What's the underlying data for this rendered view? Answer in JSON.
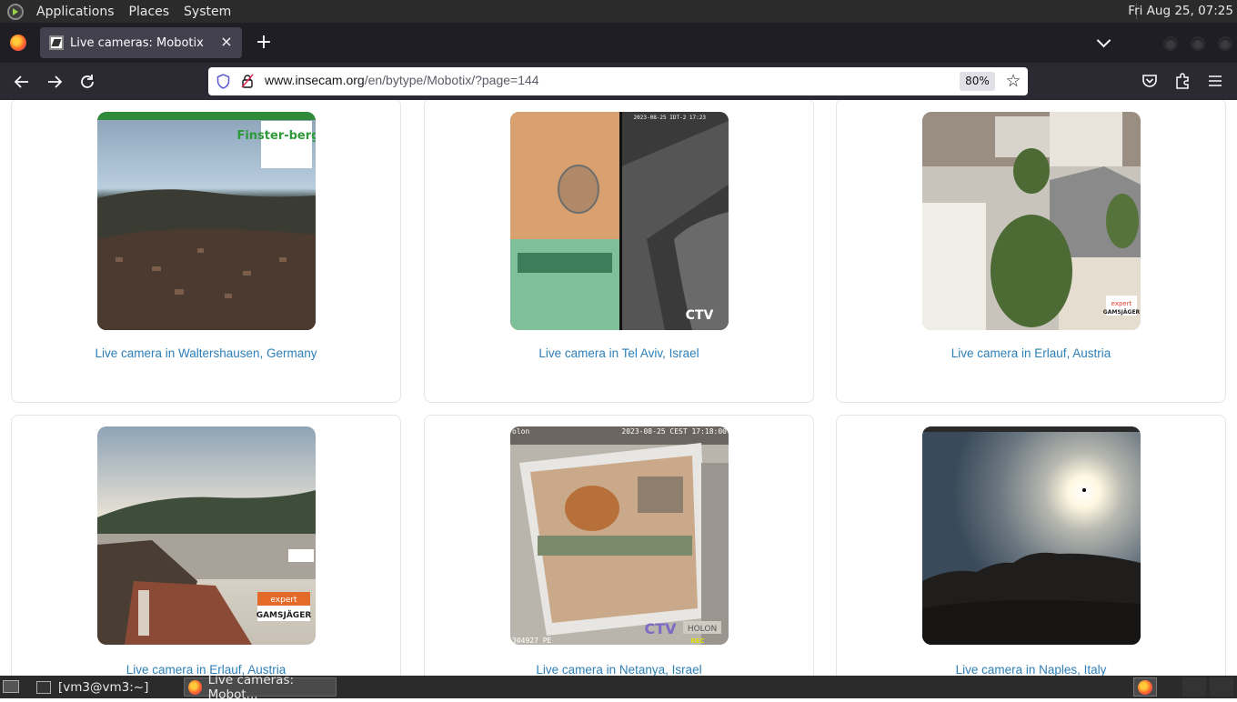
{
  "top_panel": {
    "menus": [
      "Applications",
      "Places",
      "System"
    ],
    "clock": "Fri Aug 25, 07:25"
  },
  "tab": {
    "title": "Live cameras: Mobotix",
    "close_glyph": "×",
    "new_tab_glyph": "+"
  },
  "navbar": {
    "url_host": "www.insecam.org",
    "url_path": "/en/bytype/Mobotix/?page=144",
    "zoom": "80%"
  },
  "cameras": [
    {
      "caption": "Live camera in Waltershausen, Germany"
    },
    {
      "caption": "Live camera in Tel Aviv, Israel"
    },
    {
      "caption": "Live camera in Erlauf, Austria"
    },
    {
      "caption": "Live camera in Erlauf, Austria"
    },
    {
      "caption": "Live camera in Netanya, Israel"
    },
    {
      "caption": "Live camera in Naples, Italy"
    }
  ],
  "overlays": {
    "logo_finsterbergen": "Finster-bergen",
    "ctv_label": "CTV",
    "holon_label": "HOLON",
    "rec_label": "REC",
    "expert_label": "expert",
    "gamsjager_label": "GAMSJÄGER",
    "netanya_timestamp": "2023-08-25 CEST 17:18:00",
    "netanya_id": "304927 PE",
    "netanya_stamp": "olon",
    "telaviv_timestamp": "2023-08-25 IDT-2 17:23"
  },
  "taskbar": {
    "items": [
      "[vm3@vm3:~]",
      "Live cameras: Mobot..."
    ]
  },
  "colors": {
    "link": "#2d7fb8",
    "panel": "#2b2b2b",
    "tabbar": "#1f1e25",
    "navbar": "#2b2a33"
  }
}
